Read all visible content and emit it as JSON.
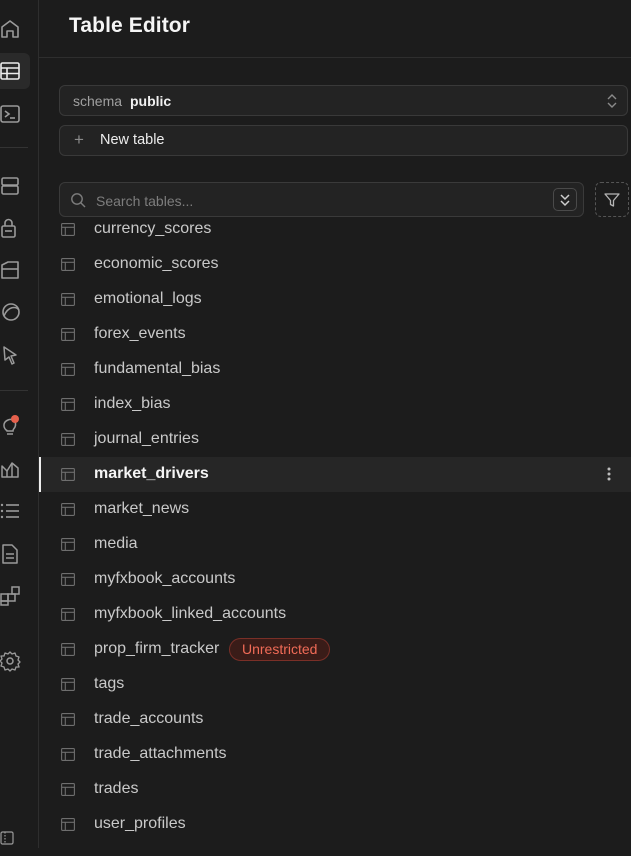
{
  "header": {
    "title": "Table Editor"
  },
  "schema": {
    "label": "schema",
    "value": "public"
  },
  "new_table": {
    "label": "New table"
  },
  "search": {
    "placeholder": "Search tables..."
  },
  "tables": [
    {
      "name": "currency_scores"
    },
    {
      "name": "economic_scores"
    },
    {
      "name": "emotional_logs"
    },
    {
      "name": "forex_events"
    },
    {
      "name": "fundamental_bias"
    },
    {
      "name": "index_bias"
    },
    {
      "name": "journal_entries"
    },
    {
      "name": "market_drivers",
      "active": true
    },
    {
      "name": "market_news"
    },
    {
      "name": "media"
    },
    {
      "name": "myfxbook_accounts"
    },
    {
      "name": "myfxbook_linked_accounts"
    },
    {
      "name": "prop_firm_tracker",
      "badge": "Unrestricted"
    },
    {
      "name": "tags"
    },
    {
      "name": "trade_accounts"
    },
    {
      "name": "trade_attachments"
    },
    {
      "name": "trades"
    },
    {
      "name": "user_profiles"
    }
  ],
  "colors": {
    "accent_badge": "#f06b57",
    "notification": "#e5604c",
    "background": "#1c1c1c"
  }
}
